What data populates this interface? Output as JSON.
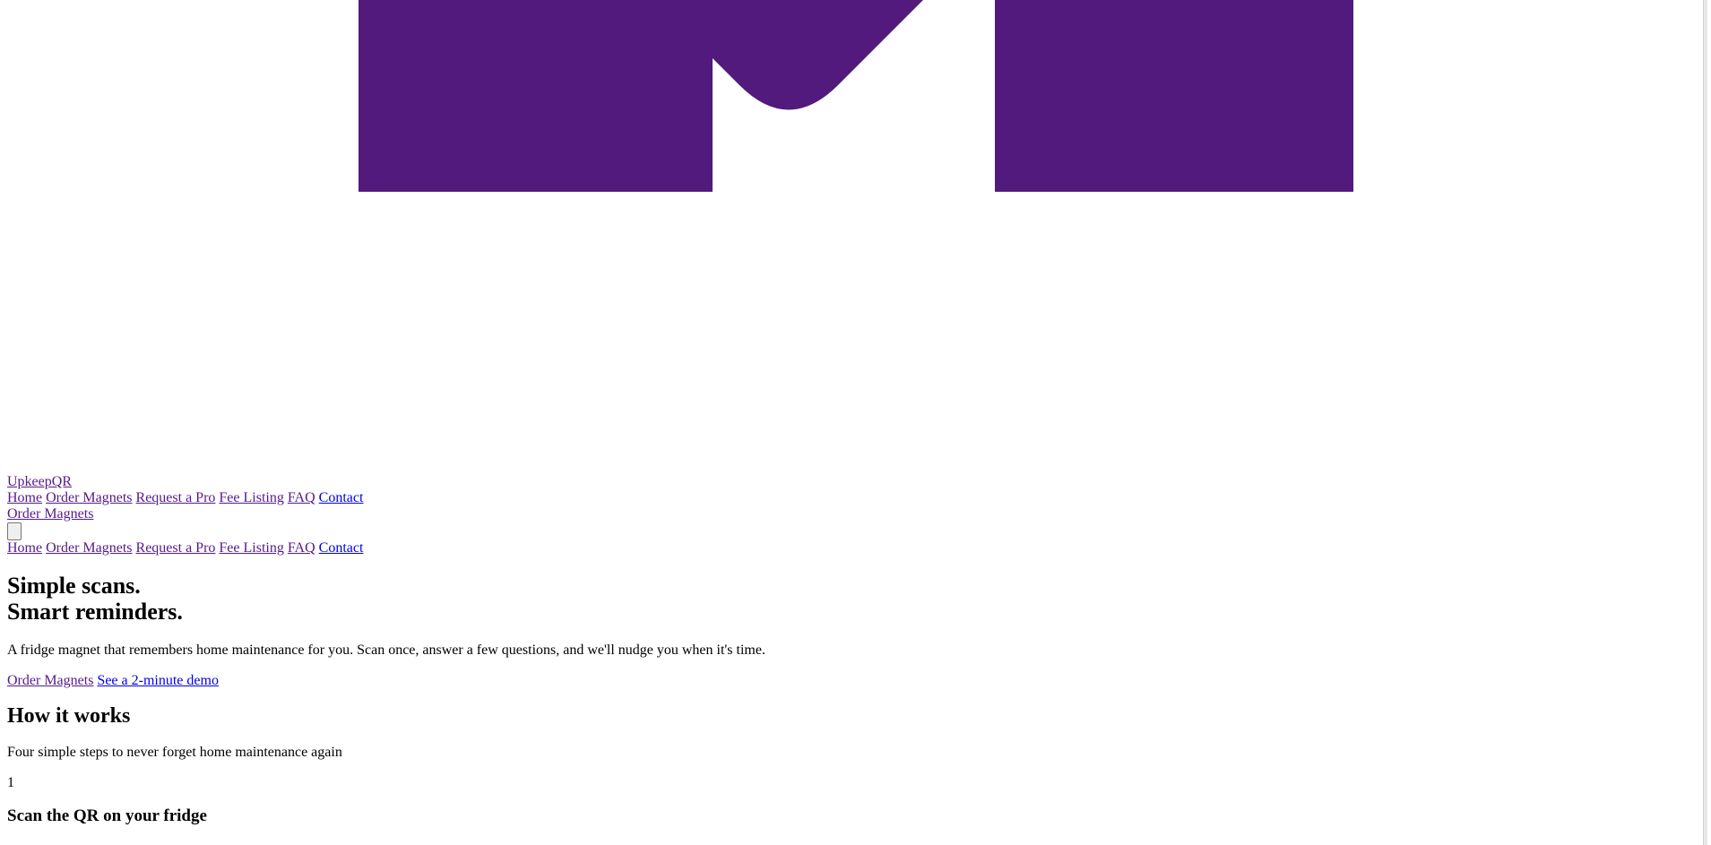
{
  "brand": {
    "name": "UpkeepQR",
    "logo_color": "#511a7c"
  },
  "nav": {
    "items": [
      "Home",
      "Order Magnets",
      "Request a Pro",
      "Fee Listing",
      "FAQ",
      "Contact"
    ],
    "cta_label": "Order Magnets",
    "menu_toggle_icon": "hamburger-menu-icon"
  },
  "mobile_nav": {
    "items": [
      "Home",
      "Order Magnets",
      "Request a Pro",
      "Fee Listing",
      "FAQ",
      "Contact"
    ]
  },
  "hero": {
    "title_line1": "Simple scans.",
    "title_line2": "Smart reminders.",
    "tagline": "A fridge magnet that remembers home maintenance for you. Scan once, answer a few questions, and we'll nudge you when it's time.",
    "primary_cta": "Order Magnets",
    "secondary_cta": "See a 2-minute demo"
  },
  "how_it_works": {
    "heading": "How it works",
    "subtitle": "Four simple steps to never forget home maintenance again",
    "steps": [
      {
        "number": "1",
        "title": "Scan the QR on your fridge"
      }
    ]
  }
}
